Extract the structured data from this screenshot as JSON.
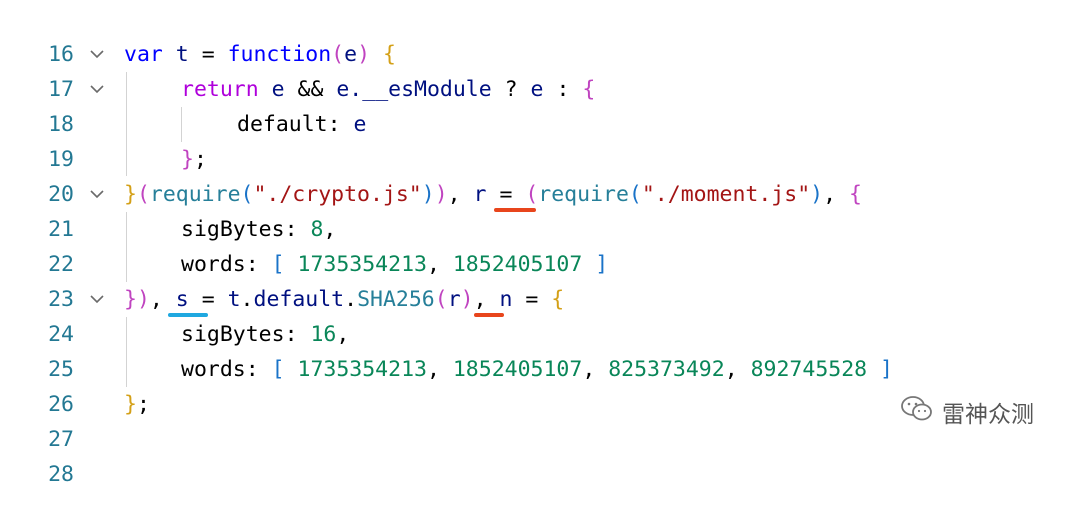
{
  "colors": {
    "keyword": "#0000ff",
    "control": "#af00db",
    "identifier": "#001080",
    "string": "#a31515",
    "number": "#098658",
    "line_number": "#237893",
    "marker_red": "#e8451c",
    "marker_blue": "#1fa8e0"
  },
  "lines": [
    {
      "n": "16"
    },
    {
      "n": "17"
    },
    {
      "n": "18"
    },
    {
      "n": "19"
    },
    {
      "n": "20"
    },
    {
      "n": "21"
    },
    {
      "n": "22"
    },
    {
      "n": "23"
    },
    {
      "n": "24"
    },
    {
      "n": "25"
    },
    {
      "n": "26"
    },
    {
      "n": "27"
    },
    {
      "n": "28"
    }
  ],
  "code": {
    "l17": {
      "var": "var",
      "t": "t",
      "eq": " = ",
      "function": "function",
      "po": "(",
      "e": "e",
      "pc": ")",
      "brace": " {"
    },
    "l18": {
      "return": "return",
      "e1": " e ",
      "and": "&&",
      "e2": " e.",
      "esmodule": "__esModule",
      "q": " ? ",
      "e3": "e",
      "colon": " : ",
      "brace": "{"
    },
    "l19": {
      "key": "default",
      "colon": ": ",
      "e": "e"
    },
    "l20": {
      "brace": "}",
      "semi": ";"
    },
    "l21": {
      "brace": "}",
      "po": "(",
      "require": "require",
      "po2": "(",
      "str": "\"./crypto.js\"",
      "pc2": ")",
      "pc": ")",
      "comma": ", ",
      "r": "r",
      "eq": " = ",
      "po3": "(",
      "require2": "require",
      "po4": "(",
      "str2": "\"./moment.js\"",
      "pc4": ")",
      "comma2": ", ",
      "brace2": "{"
    },
    "l22": {
      "key": "sigBytes",
      "colon": ": ",
      "num": "8",
      "comma": ","
    },
    "l23": {
      "key": "words",
      "colon": ": ",
      "bo": "[",
      "n1": " 1735354213",
      "comma": ", ",
      "n2": "1852405107",
      "bc": " ]"
    },
    "l24": {
      "brace": "}",
      "pc": ")",
      "comma": ", ",
      "s": "s",
      "eq": " = ",
      "t": "t",
      "dot": ".",
      "default": "default",
      "dot2": ".",
      "sha": "SHA256",
      "po": "(",
      "r": "r",
      "pc2": ")",
      "comma2": ", ",
      "n": "n",
      "eq2": " = ",
      "brace2": "{"
    },
    "l25": {
      "key": "sigBytes",
      "colon": ": ",
      "num": "16",
      "comma": ","
    },
    "l26": {
      "key": "words",
      "colon": ": ",
      "bo": "[",
      "n1": " 1735354213",
      "c1": ", ",
      "n2": "1852405107",
      "c2": ", ",
      "n3": "825373492",
      "c3": ", ",
      "n4": "892745528",
      "bc": " ]"
    },
    "l27": {
      "brace": "}",
      "semi": ";"
    }
  },
  "watermark": {
    "icon": "wechat-icon",
    "text": "雷神众测"
  }
}
